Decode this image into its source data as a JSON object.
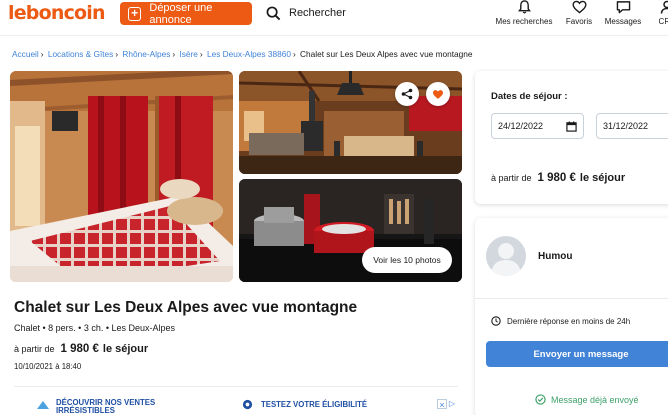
{
  "header": {
    "logo": "leboncoin",
    "post_button": "Déposer une annonce",
    "search_label": "Rechercher",
    "nav": [
      {
        "label": "Mes recherches",
        "icon": "bell-icon"
      },
      {
        "label": "Favoris",
        "icon": "heart-icon"
      },
      {
        "label": "Messages",
        "icon": "message-icon"
      },
      {
        "label": "CRA",
        "icon": "user-icon"
      }
    ]
  },
  "breadcrumb": {
    "items": [
      "Accueil",
      "Locations & Gîtes",
      "Rhône-Alpes",
      "Isère",
      "Les Deux-Alpes 38860"
    ],
    "current": "Chalet sur Les Deux Alpes avec vue montagne"
  },
  "gallery": {
    "see_photos": "Voir les 10 photos"
  },
  "listing": {
    "title": "Chalet sur Les Deux Alpes avec vue montagne",
    "meta": "Chalet • 8 pers. • 3 ch. • Les Deux-Alpes",
    "price_prefix": "à partir de",
    "price": "1 980 €",
    "price_suffix": "le séjour",
    "date": "10/10/2021 à 18:40"
  },
  "ads": {
    "left": "DÉCOUVRIR NOS VENTES IRRÉSISTIBLES",
    "right": "TESTEZ VOTRE ÉLIGIBILITÉ"
  },
  "booking": {
    "dates_label": "Dates de séjour :",
    "start_date": "24/12/2022",
    "end_date": "31/12/2022",
    "price_prefix": "à partir de",
    "price": "1 980 €",
    "price_suffix": "le séjour"
  },
  "seller": {
    "name": "Humou",
    "last_reply": "Dernière réponse en moins de 24h",
    "send_button": "Envoyer un message",
    "sent_status": "Message déjà envoyé"
  },
  "colors": {
    "brand": "#ec5a13",
    "link": "#4183d7",
    "success": "#3ea06a"
  }
}
